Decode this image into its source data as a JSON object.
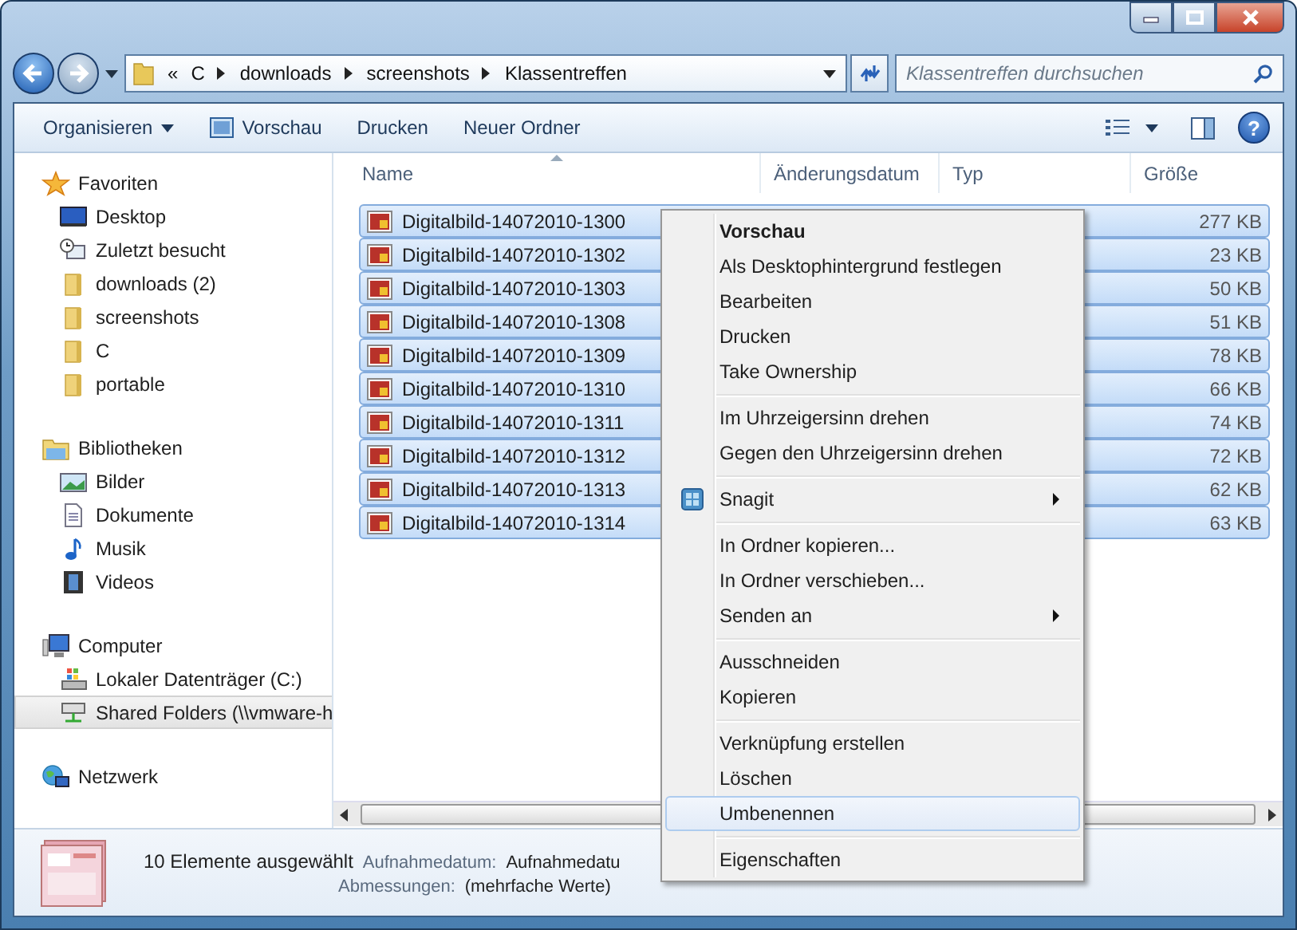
{
  "address_bar": {
    "crumbs": [
      "«",
      "C",
      "downloads",
      "screenshots",
      "Klassentreffen"
    ]
  },
  "search": {
    "placeholder": "Klassentreffen durchsuchen"
  },
  "toolbar": {
    "buttons": [
      {
        "label": "Organisieren",
        "dropdown": true
      },
      {
        "label": "Vorschau",
        "dropdown": false
      },
      {
        "label": "Drucken",
        "dropdown": false
      },
      {
        "label": "Neuer Ordner",
        "dropdown": false
      }
    ],
    "help_button": "?"
  },
  "sidebar": {
    "groups": [
      {
        "label": "Favoriten",
        "children": [
          {
            "label": "Desktop",
            "selected": false
          },
          {
            "label": "Zuletzt besucht",
            "selected": false
          },
          {
            "label": "downloads (2)",
            "selected": false
          },
          {
            "label": "screenshots",
            "selected": false
          },
          {
            "label": "C",
            "selected": false
          },
          {
            "label": "portable",
            "selected": false
          }
        ]
      },
      {
        "label": "Bibliotheken",
        "children": [
          {
            "label": "Bilder",
            "selected": false
          },
          {
            "label": "Dokumente",
            "selected": false
          },
          {
            "label": "Musik",
            "selected": false
          },
          {
            "label": "Videos",
            "selected": false
          }
        ]
      },
      {
        "label": "Computer",
        "children": [
          {
            "label": "Lokaler Datenträger (C:)",
            "selected": false
          },
          {
            "label": "Shared Folders (\\\\vmware-h",
            "selected": true
          }
        ]
      },
      {
        "label": "Netzwerk"
      }
    ]
  },
  "table": {
    "columns": [
      "Name",
      "Änderungsdatum",
      "Typ",
      "Größe"
    ],
    "rows": [
      {
        "name": "Digitalbild-14072010-1300",
        "size": "277 KB",
        "selected": true
      },
      {
        "name": "Digitalbild-14072010-1302",
        "size": "23 KB",
        "selected": true
      },
      {
        "name": "Digitalbild-14072010-1303",
        "size": "50 KB",
        "selected": true
      },
      {
        "name": "Digitalbild-14072010-1308",
        "size": "51 KB",
        "selected": true
      },
      {
        "name": "Digitalbild-14072010-1309",
        "size": "78 KB",
        "selected": true
      },
      {
        "name": "Digitalbild-14072010-1310",
        "size": "66 KB",
        "selected": true
      },
      {
        "name": "Digitalbild-14072010-1311",
        "size": "74 KB",
        "selected": true
      },
      {
        "name": "Digitalbild-14072010-1312",
        "size": "72 KB",
        "selected": true
      },
      {
        "name": "Digitalbild-14072010-1313",
        "size": "62 KB",
        "selected": true
      },
      {
        "name": "Digitalbild-14072010-1314",
        "size": "63 KB",
        "selected": true
      }
    ]
  },
  "context_menu": {
    "items": [
      {
        "kind": "item",
        "label": "Vorschau",
        "default": true,
        "submenu": false,
        "selected": false
      },
      {
        "kind": "item",
        "label": "Als Desktophintergrund festlegen",
        "default": false,
        "submenu": false,
        "selected": false
      },
      {
        "kind": "item",
        "label": "Bearbeiten",
        "default": false,
        "submenu": false,
        "selected": false
      },
      {
        "kind": "item",
        "label": "Drucken",
        "default": false,
        "submenu": false,
        "selected": false
      },
      {
        "kind": "item",
        "label": "Take Ownership",
        "default": false,
        "submenu": false,
        "selected": false
      },
      {
        "kind": "separator"
      },
      {
        "kind": "item",
        "label": "Im Uhrzeigersinn drehen",
        "default": false,
        "submenu": false,
        "selected": false
      },
      {
        "kind": "item",
        "label": "Gegen den Uhrzeigersinn drehen",
        "default": false,
        "submenu": false,
        "selected": false
      },
      {
        "kind": "separator"
      },
      {
        "kind": "icon_item",
        "label": "Snagit",
        "default": false,
        "submenu": true,
        "selected": false
      },
      {
        "kind": "separator"
      },
      {
        "kind": "item",
        "label": "In Ordner kopieren...",
        "default": false,
        "submenu": false,
        "selected": false
      },
      {
        "kind": "item",
        "label": "In Ordner verschieben...",
        "default": false,
        "submenu": false,
        "selected": false
      },
      {
        "kind": "item",
        "label": "Senden an",
        "default": false,
        "submenu": true,
        "selected": false
      },
      {
        "kind": "separator"
      },
      {
        "kind": "item",
        "label": "Ausschneiden",
        "default": false,
        "submenu": false,
        "selected": false
      },
      {
        "kind": "item",
        "label": "Kopieren",
        "default": false,
        "submenu": false,
        "selected": false
      },
      {
        "kind": "separator"
      },
      {
        "kind": "item",
        "label": "Verknüpfung erstellen",
        "default": false,
        "submenu": false,
        "selected": false
      },
      {
        "kind": "item",
        "label": "Löschen",
        "default": false,
        "submenu": false,
        "selected": false
      },
      {
        "kind": "item",
        "label": "Umbenennen",
        "default": false,
        "submenu": false,
        "selected": true
      },
      {
        "kind": "separator"
      },
      {
        "kind": "item",
        "label": "Eigenschaften",
        "default": false,
        "submenu": false,
        "selected": false
      }
    ]
  },
  "status_bar": {
    "count": "10 Elemente ausgewählt",
    "properties": [
      {
        "label": "Aufnahmedatum:",
        "value": "Aufnahmedatu"
      },
      {
        "label": "Abmessungen:",
        "value": "(mehrfache Werte)"
      }
    ]
  }
}
